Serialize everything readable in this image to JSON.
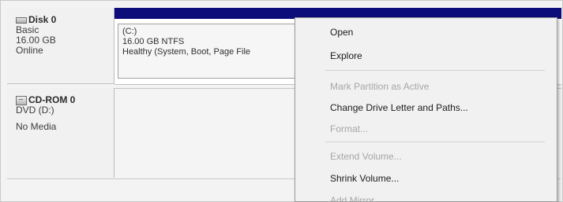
{
  "disks": [
    {
      "name": "Disk 0",
      "lines": [
        "Basic",
        "16.00 GB",
        "Online"
      ],
      "icon": "hard-disk-icon"
    },
    {
      "name": "CD-ROM 0",
      "lines": [
        "DVD (D:)",
        "No Media"
      ],
      "icon": "cd-rom-icon"
    }
  ],
  "partition": {
    "label": "(C:)",
    "size_fs": "16.00 GB NTFS",
    "status": "Healthy (System, Boot, Page File"
  },
  "context_menu": {
    "items": [
      {
        "label": "Open",
        "enabled": true
      },
      {
        "label": "Explore",
        "enabled": true
      },
      {
        "label": "Mark Partition as Active",
        "enabled": false
      },
      {
        "label": "Change Drive Letter and Paths...",
        "enabled": true
      },
      {
        "label": "Format...",
        "enabled": false
      },
      {
        "label": "Extend Volume...",
        "enabled": false
      },
      {
        "label": "Shrink Volume...",
        "enabled": true
      },
      {
        "label": "Add Mirror...",
        "enabled": false
      }
    ]
  },
  "colors": {
    "partition_header": "#0c0c7a",
    "menu_background": "#f1f1f1",
    "disabled_text": "#a6a6a6"
  }
}
